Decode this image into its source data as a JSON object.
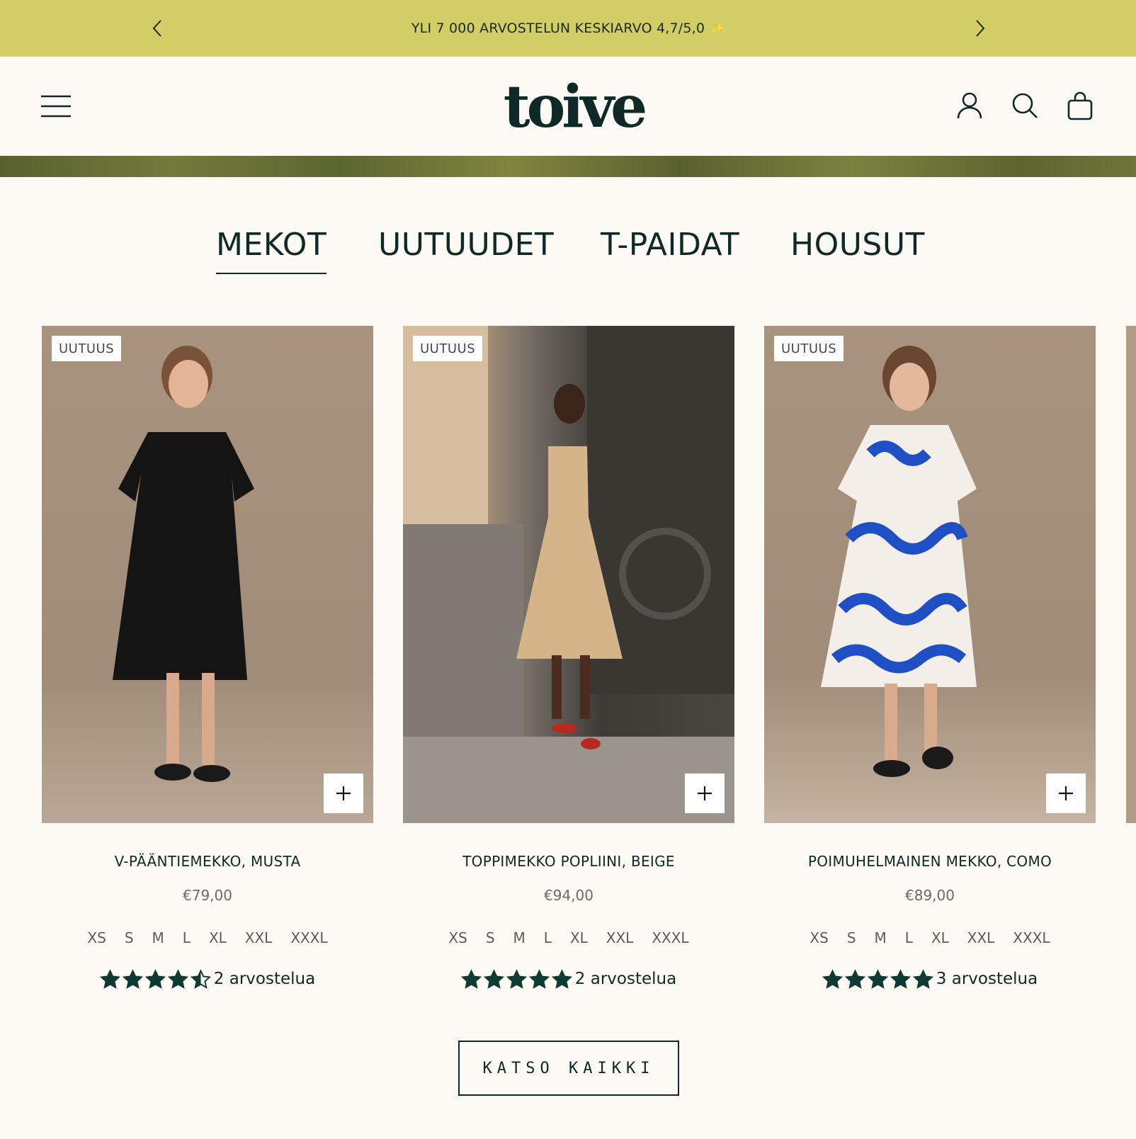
{
  "announcement": {
    "text": "YLI 7 000 ARVOSTELUN KESKIARVO 4,7/5,0",
    "spark": "✨"
  },
  "header": {
    "logo": "toive"
  },
  "tabs": [
    {
      "label": "MEKOT",
      "active": true
    },
    {
      "label": "UUTUUDET",
      "active": false
    },
    {
      "label": "T-PAIDAT",
      "active": false
    },
    {
      "label": "HOUSUT",
      "active": false
    }
  ],
  "products": [
    {
      "badge": "UUTUUS",
      "name": "V-PÄÄNTIEMEKKO, MUSTA",
      "price": "€79,00",
      "sizes": [
        "XS",
        "S",
        "M",
        "L",
        "XL",
        "XXL",
        "XXXL"
      ],
      "rating": 4.5,
      "reviews": "2 arvostelua",
      "dress_color": "#141414",
      "bg": "#a8937e"
    },
    {
      "badge": "UUTUUS",
      "name": "TOPPIMEKKO POPLIINI, BEIGE",
      "price": "€94,00",
      "sizes": [
        "XS",
        "S",
        "M",
        "L",
        "XL",
        "XXL",
        "XXXL"
      ],
      "rating": 5,
      "reviews": "2 arvostelua",
      "dress_color": "#d6b489",
      "bg": "#8a7866"
    },
    {
      "badge": "UUTUUS",
      "name": "POIMUHELMAINEN MEKKO, COMO",
      "price": "€89,00",
      "sizes": [
        "XS",
        "S",
        "M",
        "L",
        "XL",
        "XXL",
        "XXXL"
      ],
      "rating": 5,
      "reviews": "3 arvostelua",
      "dress_color": "#1f4fc4",
      "bg": "#a8937e"
    }
  ],
  "view_all_label": "KATSO KAIKKI"
}
